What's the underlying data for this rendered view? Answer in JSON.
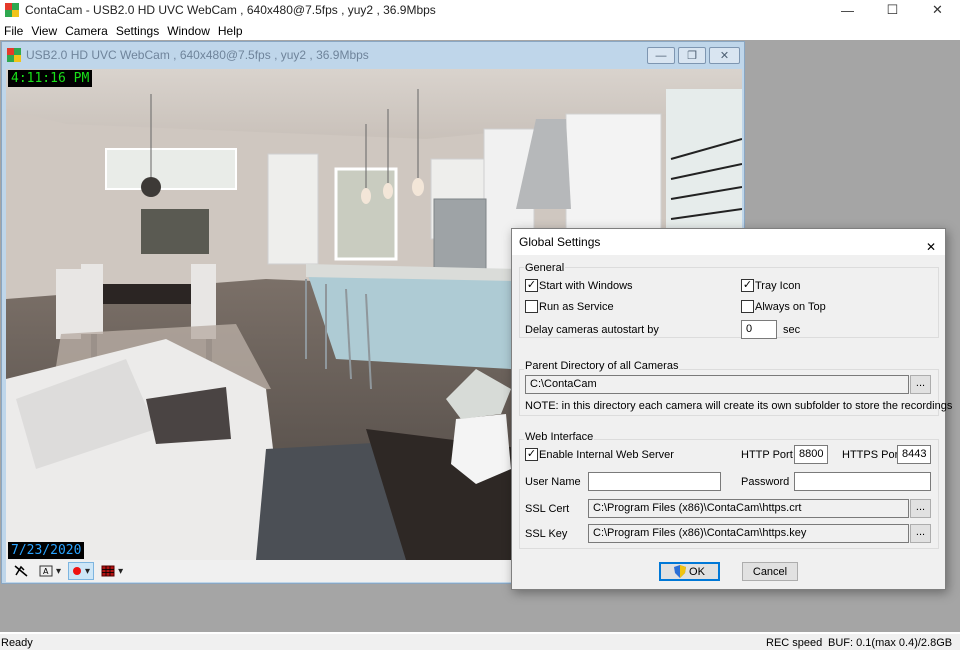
{
  "app": {
    "title": "ContaCam - USB2.0 HD UVC WebCam , 640x480@7.5fps , yuy2 , 36.9Mbps",
    "window_controls": [
      "—",
      "☐",
      "✕"
    ]
  },
  "menu": [
    "File",
    "View",
    "Camera",
    "Settings",
    "Window",
    "Help"
  ],
  "camera_window": {
    "title": "USB2.0 HD UVC WebCam , 640x480@7.5fps , yuy2 , 36.9Mbps",
    "overlay_time": "4:11:16 PM",
    "overlay_date": "7/23/2020",
    "toolbar": {
      "snapshot_icon": "camera-off-icon",
      "text_icon": "text-overlay-icon",
      "record_icon": "record-icon",
      "detection_icon": "detection-zones-icon"
    }
  },
  "dialog": {
    "title": "Global Settings",
    "general": {
      "label": "General",
      "start_with_windows": {
        "label": "Start with Windows",
        "checked": true
      },
      "tray_icon": {
        "label": "Tray Icon",
        "checked": true
      },
      "run_as_service": {
        "label": "Run as Service",
        "checked": false
      },
      "always_on_top": {
        "label": "Always on Top",
        "checked": false
      },
      "delay_label": "Delay cameras autostart by",
      "delay_value": "0",
      "delay_unit": "sec"
    },
    "parent_dir": {
      "label": "Parent Directory of all Cameras",
      "value": "C:\\ContaCam",
      "browse": "...",
      "note": "NOTE: in this directory each camera will create its own subfolder to store the recordings"
    },
    "web": {
      "label": "Web Interface",
      "enable_server": {
        "label": "Enable Internal Web Server",
        "checked": true
      },
      "http_label": "HTTP Port",
      "http_value": "8800",
      "https_label": "HTTPS Port",
      "https_value": "8443",
      "user_label": "User Name",
      "user_value": "",
      "pass_label": "Password",
      "pass_value": "",
      "ssl_cert_label": "SSL Cert",
      "ssl_cert_value": "C:\\Program Files (x86)\\ContaCam\\https.crt",
      "ssl_key_label": "SSL Key",
      "ssl_key_value": "C:\\Program Files (x86)\\ContaCam\\https.key",
      "browse": "..."
    },
    "ok_label": "OK",
    "cancel_label": "Cancel"
  },
  "status": {
    "left": "Ready",
    "rec_speed": "REC speed",
    "buf": "BUF: 0.1(max 0.4)/2.8GB"
  }
}
